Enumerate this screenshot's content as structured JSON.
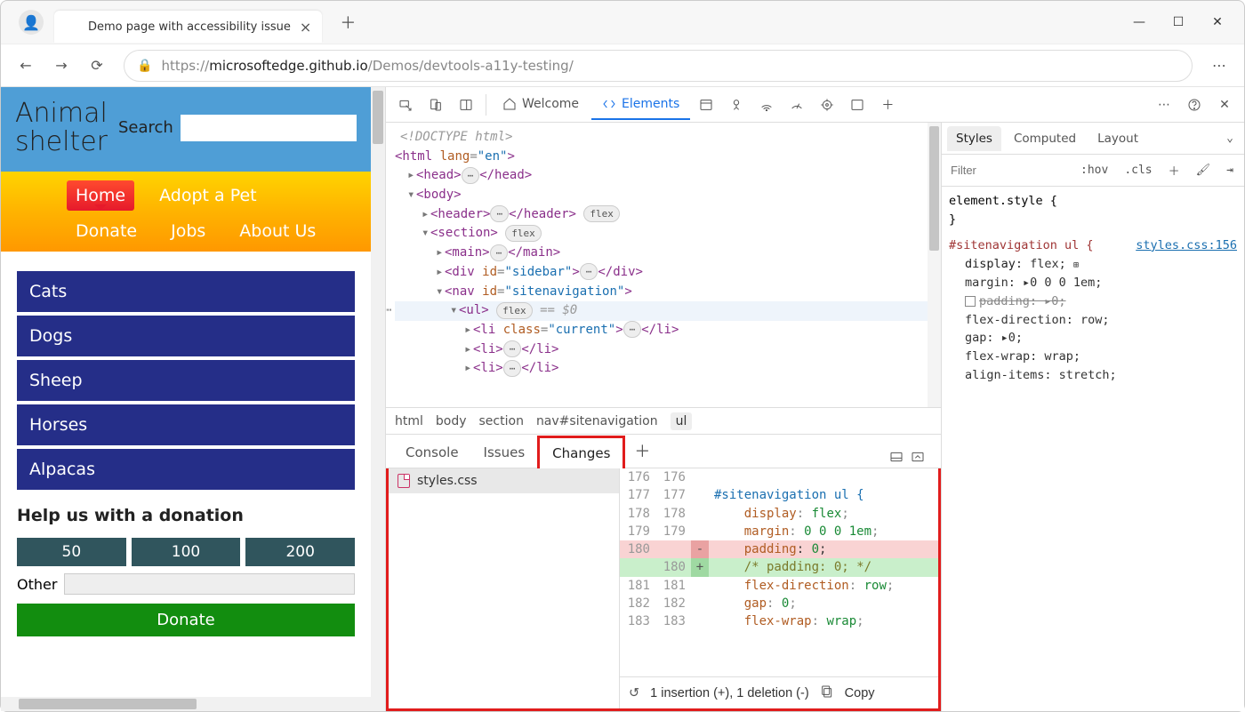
{
  "browser": {
    "tab_title": "Demo page with accessibility issue",
    "url_prefix": "https://",
    "url_host": "microsoftedge.github.io",
    "url_path": "/Demos/devtools-a11y-testing/"
  },
  "page": {
    "title_line1": "Animal",
    "title_line2": "shelter",
    "search_label": "Search",
    "nav": {
      "home": "Home",
      "adopt": "Adopt a Pet",
      "donate": "Donate",
      "jobs": "Jobs",
      "about": "About Us"
    },
    "sidebar": [
      "Cats",
      "Dogs",
      "Sheep",
      "Horses",
      "Alpacas"
    ],
    "donation": {
      "heading": "Help us with a donation",
      "amounts": [
        "50",
        "100",
        "200"
      ],
      "other_label": "Other",
      "donate_button": "Donate"
    }
  },
  "devtools": {
    "tabs": {
      "welcome": "Welcome",
      "elements": "Elements"
    },
    "crumbs": [
      "html",
      "body",
      "section",
      "nav#sitenavigation",
      "ul"
    ],
    "dom": {
      "doctype": "<!DOCTYPE html>",
      "html_open": "<html lang=\"en\">",
      "head": "<head>…</head>",
      "body": "<body>",
      "header": "<header>…</header>",
      "header_badge": "flex",
      "section": "<section>",
      "section_badge": "flex",
      "main": "<main>…</main>",
      "sidebar_div": "<div id=\"sidebar\">…</div>",
      "nav": "<nav id=\"sitenavigation\">",
      "ul": "<ul>",
      "ul_badge": "flex",
      "ul_hint": "== $0",
      "li_current": "<li class=\"current\">…</li>",
      "li1": "<li>…</li>",
      "li2": "<li>…</li>"
    },
    "styles": {
      "tabs": {
        "styles": "Styles",
        "computed": "Computed",
        "layout": "Layout"
      },
      "filter_placeholder": "Filter",
      "hov": ":hov",
      "cls": ".cls",
      "element_style": "element.style {",
      "close_brace": "}",
      "rule_selector": "#sitenavigation ul {",
      "rule_link": "styles.css:156",
      "props": {
        "display": "display: flex;",
        "margin": "margin: ▸0 0 0 1em;",
        "padding": "padding: ▸0;",
        "flexdir": "flex-direction: row;",
        "gap": "gap: ▸0;",
        "wrap": "flex-wrap: wrap;",
        "align": "align-items: stretch;"
      }
    },
    "drawer": {
      "tabs": {
        "console": "Console",
        "issues": "Issues",
        "changes": "Changes"
      },
      "file": "styles.css",
      "status": "1 insertion (+), 1 deletion (-)",
      "copy": "Copy",
      "diff": [
        {
          "ol": "176",
          "nl": "176",
          "t": "ctx",
          "code": ""
        },
        {
          "ol": "177",
          "nl": "177",
          "t": "ctx",
          "code": "#sitenavigation ul {",
          "cls": "sel"
        },
        {
          "ol": "178",
          "nl": "178",
          "t": "ctx",
          "code": "    display: flex;"
        },
        {
          "ol": "179",
          "nl": "179",
          "t": "ctx",
          "code": "    margin: 0 0 0 1em;"
        },
        {
          "ol": "180",
          "nl": "",
          "t": "del",
          "code": "    padding: 0;"
        },
        {
          "ol": "",
          "nl": "180",
          "t": "add",
          "code": "    /* padding: 0; */",
          "cls": "cmt"
        },
        {
          "ol": "181",
          "nl": "181",
          "t": "ctx",
          "code": "    flex-direction: row;"
        },
        {
          "ol": "182",
          "nl": "182",
          "t": "ctx",
          "code": "    gap: 0;"
        },
        {
          "ol": "183",
          "nl": "183",
          "t": "ctx",
          "code": "    flex-wrap: wrap;"
        }
      ]
    }
  }
}
